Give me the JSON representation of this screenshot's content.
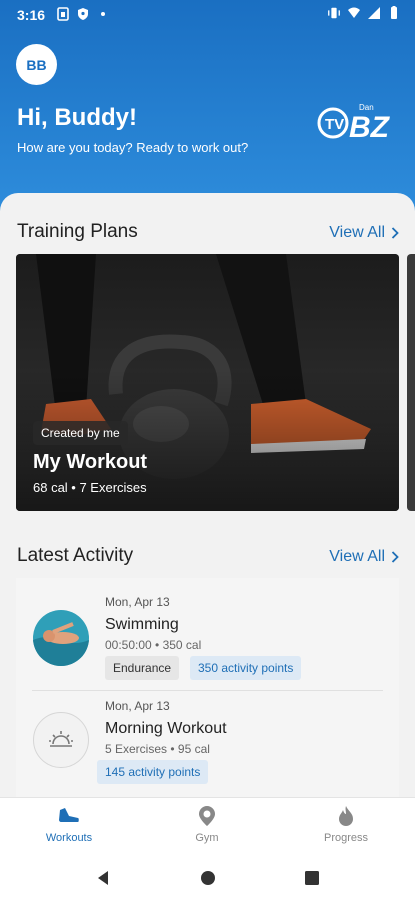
{
  "status_bar": {
    "time": "3:16"
  },
  "header": {
    "avatar_initials": "BB",
    "greeting": "Hi, Buddy!",
    "subtitle": "How are you today? Ready to work out?",
    "brand_logo_text": "TV Dan BZ"
  },
  "training_plans": {
    "title": "Training Plans",
    "view_all": "View All",
    "cards": [
      {
        "chip": "Created by me",
        "name": "My Workout",
        "meta": "68 cal • 7 Exercises"
      }
    ]
  },
  "latest_activity": {
    "title": "Latest Activity",
    "view_all": "View All",
    "items": [
      {
        "date": "Mon, Apr 13",
        "name": "Swimming",
        "meta": "00:50:00 • 350 cal",
        "tags": [
          "Endurance",
          "350 activity points"
        ]
      },
      {
        "date": "Mon, Apr 13",
        "name": "Morning Workout",
        "meta": "5 Exercises • 95 cal",
        "tags": [
          "145 activity points"
        ]
      }
    ]
  },
  "bottom_nav": {
    "items": [
      {
        "label": "Workouts",
        "icon": "sneaker-icon",
        "active": true
      },
      {
        "label": "Gym",
        "icon": "location-pin-icon",
        "active": false
      },
      {
        "label": "Progress",
        "icon": "flame-icon",
        "active": false
      }
    ]
  },
  "colors": {
    "header_top": "#1a6fc2",
    "header_bottom": "#2e8ddc",
    "accent": "#1f6fb6",
    "sheet_bg": "#f2f2f2"
  }
}
